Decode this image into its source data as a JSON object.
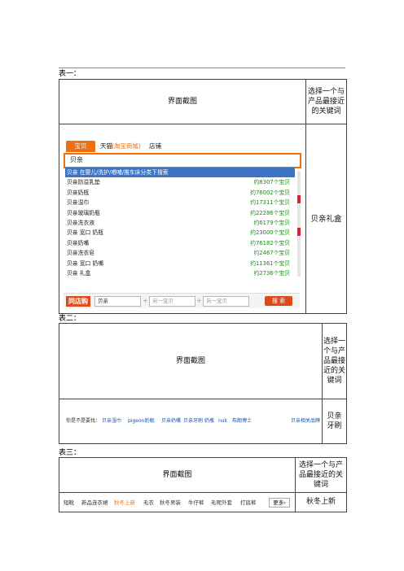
{
  "tables": [
    {
      "label": "表一：",
      "header_left": "界面截图",
      "header_right": "选择一个与产品最接近的关键词",
      "answer": "贝亲礼盒",
      "screenshot": {
        "tabs": [
          "宝贝",
          "天猫",
          "(淘宝商城)",
          "店铺"
        ],
        "query": "贝亲",
        "suggestions": [
          {
            "keyword": "贝亲 在婴儿/洗护/喂哺/推车床分类下搜索",
            "count": ""
          },
          {
            "keyword": "贝亲防溢乳垫",
            "count": "约8307个宝贝"
          },
          {
            "keyword": "贝亲奶瓶",
            "count": "约76002个宝贝"
          },
          {
            "keyword": "贝亲湿巾",
            "count": "约17311个宝贝"
          },
          {
            "keyword": "贝亲玻璃奶瓶",
            "count": "约22286个宝贝"
          },
          {
            "keyword": "贝亲洗衣液",
            "count": "约6179个宝贝"
          },
          {
            "keyword": "贝亲 宽口 奶瓶",
            "count": "约23000个宝贝"
          },
          {
            "keyword": "贝亲奶嘴",
            "count": "约76182个宝贝"
          },
          {
            "keyword": "贝亲洗衣皂",
            "count": "约2467个宝贝"
          },
          {
            "keyword": "贝亲 宽口 奶嘴",
            "count": "约11361个宝贝"
          },
          {
            "keyword": "贝亲 礼盒",
            "count": "约2736个宝贝"
          }
        ],
        "brand_logo": "同店购",
        "bottom_input": "贝亲",
        "placeholder1": "另一宝贝",
        "placeholder2": "另一宝贝",
        "search_button": "搜 索"
      }
    },
    {
      "label": "表二：",
      "header_left": "界面截图",
      "header_right": "选择一个与产品最接近的关键词",
      "answer": "贝亲牙刷",
      "screenshot": {
        "lead": "你是不是要找：",
        "related": [
          "贝亲湿巾",
          "pigeon奶瓶",
          "贝亲奶嘴",
          "贝亲牙刷",
          "奶瓶",
          "nuk",
          "布朗博士"
        ],
        "extra": "贝亲相关品牌"
      }
    },
    {
      "label": "表三：",
      "header_left": "界面截图",
      "header_right": "选择一个与产品最接近的关键词",
      "answer": "秋冬上新",
      "screenshot": {
        "keywords": [
          "短靴",
          "新品连衣裙",
          "秋冬上新",
          "毛衣",
          "秋冬男装",
          "牛仔裤",
          "毛呢外套",
          "打底裤"
        ],
        "selected_index": 2,
        "more": "更多"
      }
    }
  ]
}
